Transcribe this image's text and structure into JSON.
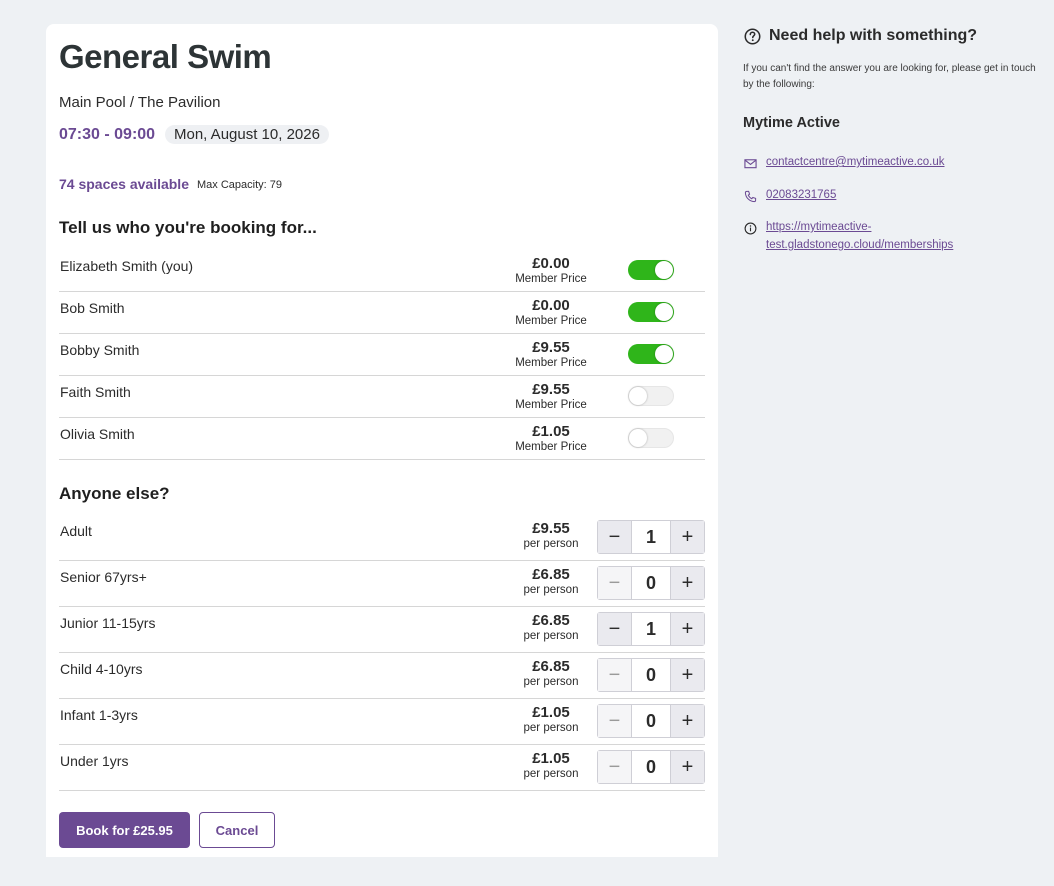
{
  "session": {
    "title": "General Swim",
    "location": "Main Pool / The Pavilion",
    "time": "07:30 - 09:00",
    "date": "Mon, August 10, 2026",
    "spaces": "74 spaces available",
    "capacity": "Max Capacity: 79"
  },
  "booking_for": {
    "heading": "Tell us who you're booking for...",
    "members": [
      {
        "name": "Elizabeth Smith (you)",
        "price": "£0.00",
        "price_label": "Member Price",
        "selected": true
      },
      {
        "name": "Bob Smith",
        "price": "£0.00",
        "price_label": "Member Price",
        "selected": true
      },
      {
        "name": "Bobby Smith",
        "price": "£9.55",
        "price_label": "Member Price",
        "selected": true
      },
      {
        "name": "Faith Smith",
        "price": "£9.55",
        "price_label": "Member Price",
        "selected": false
      },
      {
        "name": "Olivia Smith",
        "price": "£1.05",
        "price_label": "Member Price",
        "selected": false
      }
    ]
  },
  "anyone_else": {
    "heading": "Anyone else?",
    "tickets": [
      {
        "name": "Adult",
        "price": "£9.55",
        "price_label": "per person",
        "qty": "1",
        "minus": "−",
        "plus": "+"
      },
      {
        "name": "Senior 67yrs+",
        "price": "£6.85",
        "price_label": "per person",
        "qty": "0",
        "minus": "−",
        "plus": "+"
      },
      {
        "name": "Junior 11-15yrs",
        "price": "£6.85",
        "price_label": "per person",
        "qty": "1",
        "minus": "−",
        "plus": "+"
      },
      {
        "name": "Child 4-10yrs",
        "price": "£6.85",
        "price_label": "per person",
        "qty": "0",
        "minus": "−",
        "plus": "+"
      },
      {
        "name": "Infant 1-3yrs",
        "price": "£1.05",
        "price_label": "per person",
        "qty": "0",
        "minus": "−",
        "plus": "+"
      },
      {
        "name": "Under 1yrs",
        "price": "£1.05",
        "price_label": "per person",
        "qty": "0",
        "minus": "−",
        "plus": "+"
      }
    ]
  },
  "actions": {
    "book_label": "Book for £25.95",
    "cancel_label": "Cancel"
  },
  "help": {
    "title": "Need help with something?",
    "description": "If you can't find the answer you are looking for, please get in touch by the following:",
    "org": "Mytime Active",
    "email": "contactcentre@mytimeactive.co.uk",
    "phone": "02083231765",
    "website": "https://mytimeactive-test.gladstonego.cloud/memberships"
  },
  "colors": {
    "brand": "#6b4a93",
    "toggle_on": "#2fb51a",
    "background": "#eef1f4"
  },
  "icons": {
    "help": "question-circle-icon",
    "email": "envelope-icon",
    "phone": "phone-icon",
    "website": "info-circle-icon"
  }
}
